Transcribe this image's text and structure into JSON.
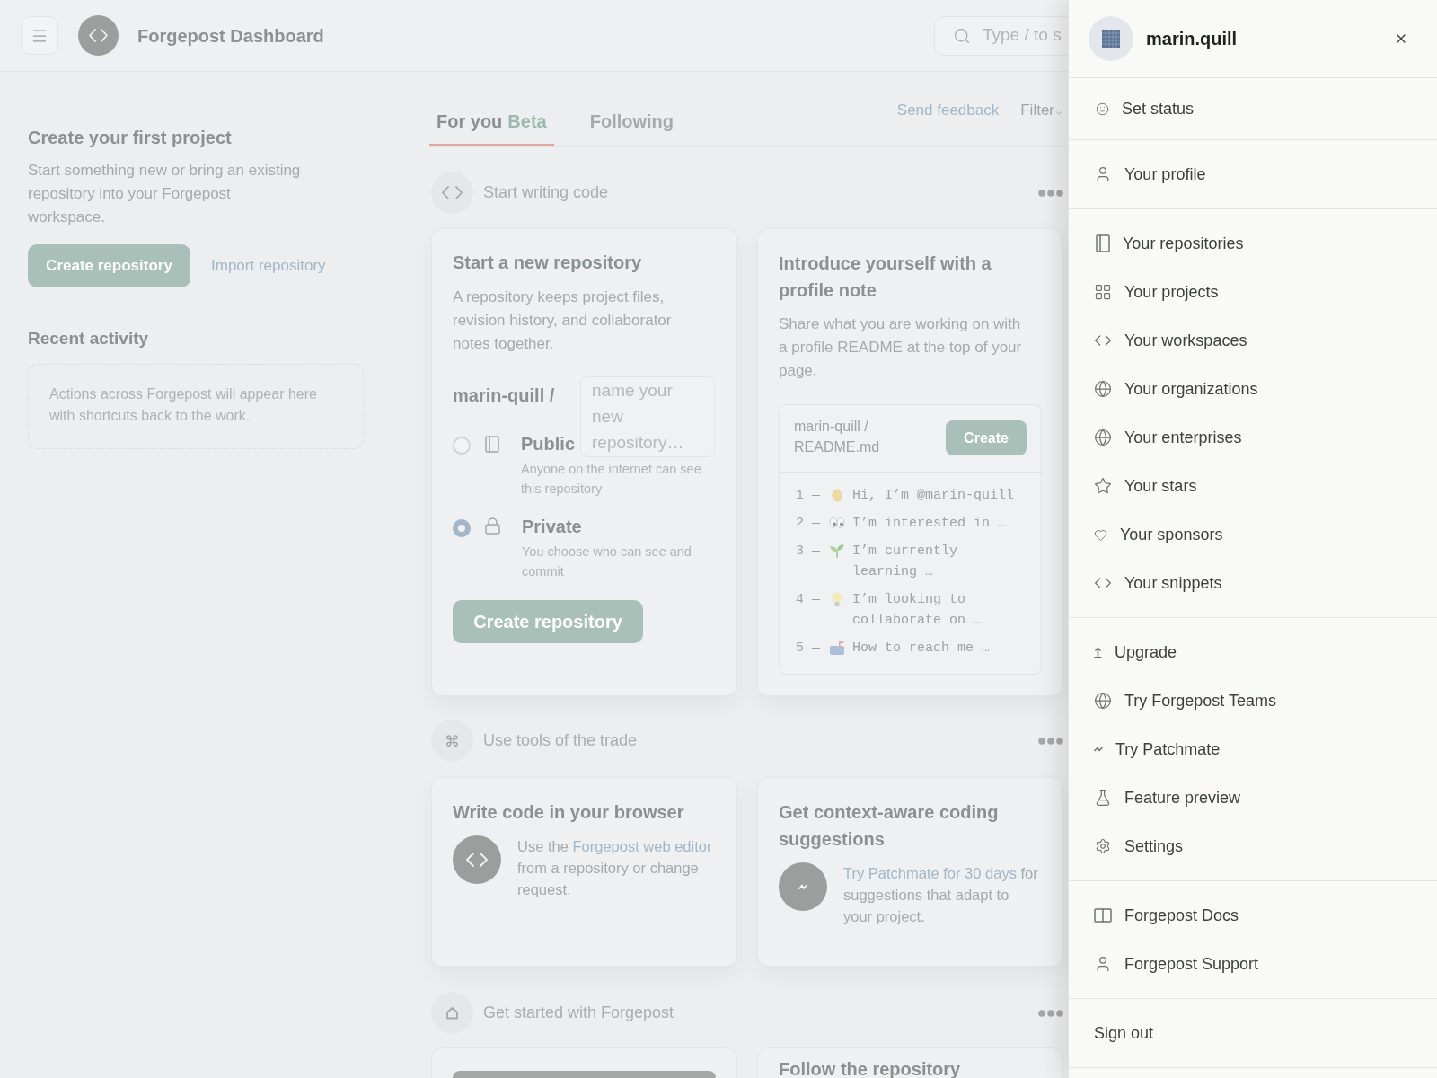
{
  "header": {
    "title": "Forgepost Dashboard",
    "search": {
      "placeholder": "Type / to s"
    }
  },
  "sidebar": {
    "title": "Create your first project",
    "description": "Start something new or bring an existing repository into your Forgepost workspace.",
    "primary_button": "Create repository",
    "secondary_link": "Import repository",
    "recent": {
      "title": "Recent activity",
      "empty_text": "Actions across Forgepost will appear here with shortcuts back to the work."
    }
  },
  "feed": {
    "tabs": [
      {
        "label": "For you",
        "badge": "Beta",
        "selected": true
      },
      {
        "label": "Following",
        "selected": false
      }
    ],
    "feedback_link": "Send feedback",
    "filter": "Filter",
    "sections": [
      {
        "title": "Start writing code",
        "cards": [
          {
            "kind": "new_repository",
            "title": "Start a new repository",
            "description": "A repository keeps project files, revision history, and collaborator notes together.",
            "owner": "marin-quill /",
            "name_field": {
              "placeholder": "name your new repository…"
            },
            "visibility": [
              {
                "label": "Public",
                "description": "Anyone on the internet can see this repository",
                "selected": false
              },
              {
                "label": "Private",
                "description": "You choose who can see and commit",
                "selected": true
              }
            ],
            "button": "Create repository"
          },
          {
            "kind": "profile_note",
            "title": "Introduce yourself with a profile note",
            "description": "Share what you are working on with a profile README at the top of your page.",
            "file": "marin-quill / README.md",
            "button": "Create",
            "lines": [
              {
                "prefix": "1 —",
                "text": "Hi, I’m @marin-quill"
              },
              {
                "prefix": "2 —",
                "text": "I’m interested in …"
              },
              {
                "prefix": "3 —",
                "text": "I’m currently learning …"
              },
              {
                "prefix": "4 —",
                "text": "I’m looking to collaborate on …"
              },
              {
                "prefix": "5 —",
                "text": "How to reach me …"
              }
            ]
          }
        ]
      },
      {
        "title": "Use tools of the trade",
        "cards": [
          {
            "kind": "tool",
            "title": "Write code in your browser",
            "text_before": "Use the ",
            "link": "Forgepost web editor",
            "text_after": " from a repository or change request."
          },
          {
            "kind": "tool",
            "title": "Get context-aware coding suggestions",
            "link": "Try Patchmate for 30 days",
            "text_after": " for suggestions that adapt to your project."
          }
        ]
      },
      {
        "title": "Get started with Forgepost",
        "cards": [
          {
            "kind": "image"
          },
          {
            "kind": "title_only",
            "title": "Follow the repository"
          }
        ]
      }
    ]
  },
  "account_menu": {
    "username": "marin.quill",
    "sections": [
      {
        "items": [
          {
            "label": "Set status"
          }
        ]
      },
      {
        "items": [
          {
            "label": "Your profile"
          }
        ]
      },
      {
        "items": [
          {
            "label": "Your repositories"
          },
          {
            "label": "Your projects"
          },
          {
            "label": "Your workspaces"
          },
          {
            "label": "Your organizations"
          },
          {
            "label": "Your enterprises"
          },
          {
            "label": "Your stars"
          },
          {
            "label": "Your sponsors"
          },
          {
            "label": "Your snippets"
          }
        ]
      },
      {
        "items": [
          {
            "label": "Upgrade"
          },
          {
            "label": "Try Forgepost Teams"
          },
          {
            "label": "Try Patchmate"
          },
          {
            "label": "Feature preview"
          },
          {
            "label": "Settings"
          }
        ]
      },
      {
        "items": [
          {
            "label": "Forgepost Docs"
          },
          {
            "label": "Forgepost Support"
          }
        ]
      },
      {
        "items": [
          {
            "label": "Sign out"
          }
        ]
      }
    ]
  }
}
